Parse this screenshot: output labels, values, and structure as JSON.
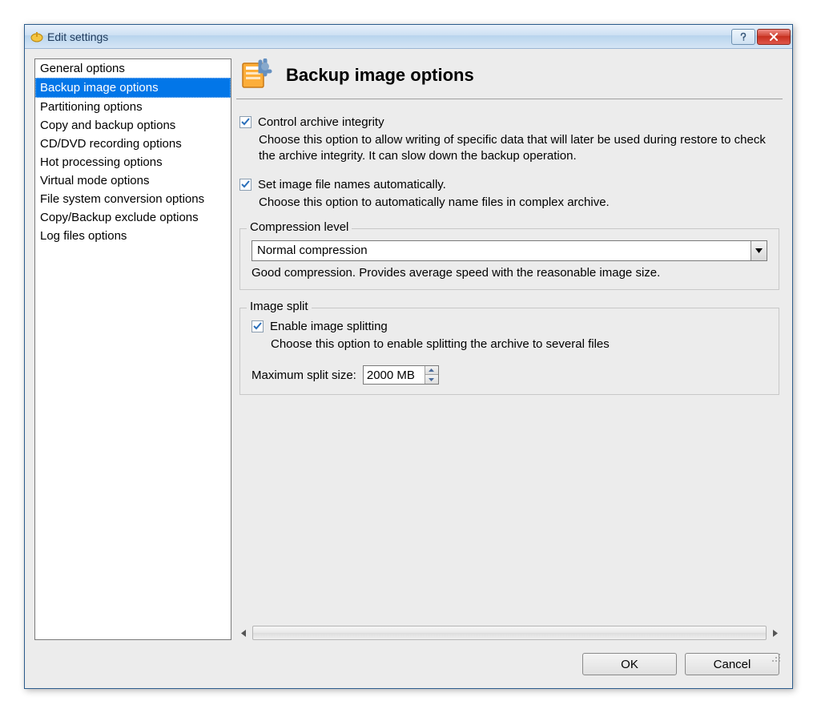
{
  "title": "Edit settings",
  "sidebar": {
    "items": [
      {
        "label": "General options",
        "selected": false
      },
      {
        "label": "Backup image options",
        "selected": true
      },
      {
        "label": "Partitioning options",
        "selected": false
      },
      {
        "label": "Copy and backup options",
        "selected": false
      },
      {
        "label": "CD/DVD recording options",
        "selected": false
      },
      {
        "label": "Hot processing options",
        "selected": false
      },
      {
        "label": "Virtual mode options",
        "selected": false
      },
      {
        "label": "File system conversion options",
        "selected": false
      },
      {
        "label": "Copy/Backup exclude options",
        "selected": false
      },
      {
        "label": "Log files options",
        "selected": false
      }
    ]
  },
  "panel": {
    "title": "Backup image options",
    "integrity": {
      "label": "Control archive integrity",
      "checked": true,
      "desc": "Choose this option to allow writing of specific data that will later be used during restore to check the archive integrity. It can slow down the backup operation."
    },
    "autoname": {
      "label": "Set image file names automatically.",
      "checked": true,
      "desc": "Choose this option to automatically name files in complex archive."
    },
    "compression": {
      "group_title": "Compression level",
      "value": "Normal compression",
      "desc": "Good compression. Provides average speed with the reasonable image size."
    },
    "split": {
      "group_title": "Image split",
      "enable_label": "Enable image splitting",
      "enable_checked": true,
      "enable_desc": "Choose this option to enable splitting the archive to several files",
      "size_label": "Maximum split size:",
      "size_value": "2000 MB"
    }
  },
  "buttons": {
    "ok": "OK",
    "cancel": "Cancel"
  }
}
